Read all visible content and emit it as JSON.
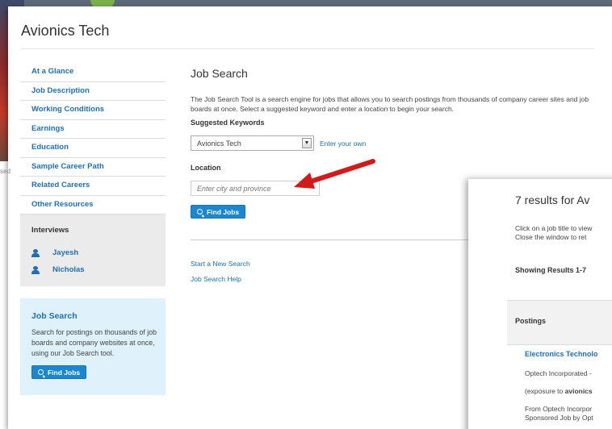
{
  "page": {
    "title": "Avionics Tech"
  },
  "background": {
    "caption": "sed"
  },
  "nav": {
    "items": [
      "At a Glance",
      "Job Description",
      "Working Conditions",
      "Earnings",
      "Education",
      "Sample Career Path",
      "Related Careers",
      "Other Resources"
    ]
  },
  "interviews": {
    "heading": "Interviews",
    "people": [
      "Jayesh",
      "Nicholas"
    ]
  },
  "job_search_box": {
    "heading": "Job Search",
    "text": "Search for postings on thousands of job boards and company websites at once, using our Job Search tool.",
    "button": "Find Jobs"
  },
  "main": {
    "heading": "Job Search",
    "description": "The Job Search Tool is a search engine for jobs that allows you to search postings from thousands of company career sites and job boards at once. Select a suggested keyword and enter a location to begin your search.",
    "keywords_label": "Suggested Keywords",
    "keyword_selected": "Avionics Tech",
    "enter_own": "Enter your own",
    "location_label": "Location",
    "location_placeholder": "Enter city and province",
    "button": "Find Jobs",
    "links": [
      "Start a New Search",
      "Job Search Help"
    ]
  },
  "results": {
    "heading": "7 results for Av",
    "line1": "Click on a job title to view",
    "line2": "Close the window to ret",
    "showing": "Showing Results 1-7",
    "postings_header": "Postings",
    "job_title": "Electronics Technolo",
    "job_company": "Optech Incorporated -",
    "job_snippet_prefix": "(exposure to ",
    "job_snippet_bold": "avionics",
    "job_from": "From Optech Incorpor",
    "job_sponsored": "Sponsored Job by Opt"
  },
  "colors": {
    "link": "#1f6fb5",
    "button": "#1b87d0",
    "arrow": "#d11a1a"
  },
  "icons": {
    "person": "person-icon",
    "search": "magnifier-icon",
    "dropdown": "chevron-down-icon"
  }
}
